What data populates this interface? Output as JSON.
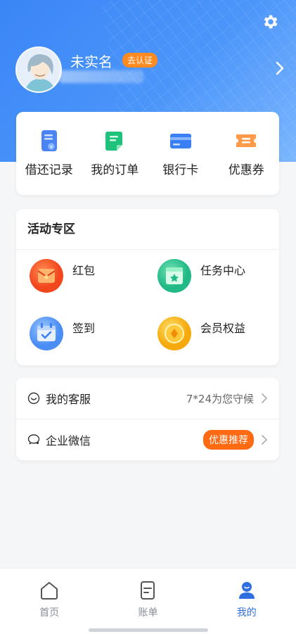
{
  "header": {
    "username": "未实名",
    "verify_badge": "去认证"
  },
  "quick_actions": [
    {
      "label": "借还记录",
      "icon": "loan-record-icon"
    },
    {
      "label": "我的订单",
      "icon": "order-icon"
    },
    {
      "label": "银行卡",
      "icon": "bank-card-icon"
    },
    {
      "label": "优惠券",
      "icon": "coupon-icon"
    }
  ],
  "activity": {
    "title": "活动专区",
    "items": [
      {
        "label": "红包",
        "icon": "red-packet-icon"
      },
      {
        "label": "任务中心",
        "icon": "task-center-icon"
      },
      {
        "label": "签到",
        "icon": "check-in-icon"
      },
      {
        "label": "会员权益",
        "icon": "membership-icon"
      }
    ]
  },
  "service": {
    "customer_service": {
      "label": "我的客服",
      "hint": "7*24为您守候"
    },
    "wechat": {
      "label": "企业微信",
      "badge": "优惠推荐"
    }
  },
  "tabbar": [
    {
      "label": "首页",
      "icon": "home-icon"
    },
    {
      "label": "账单",
      "icon": "bill-icon"
    },
    {
      "label": "我的",
      "icon": "profile-icon",
      "active": true
    }
  ],
  "colors": {
    "primary": "#3a86f6",
    "accent_orange": "#ff6a13",
    "active_tab": "#2f6fe0"
  }
}
